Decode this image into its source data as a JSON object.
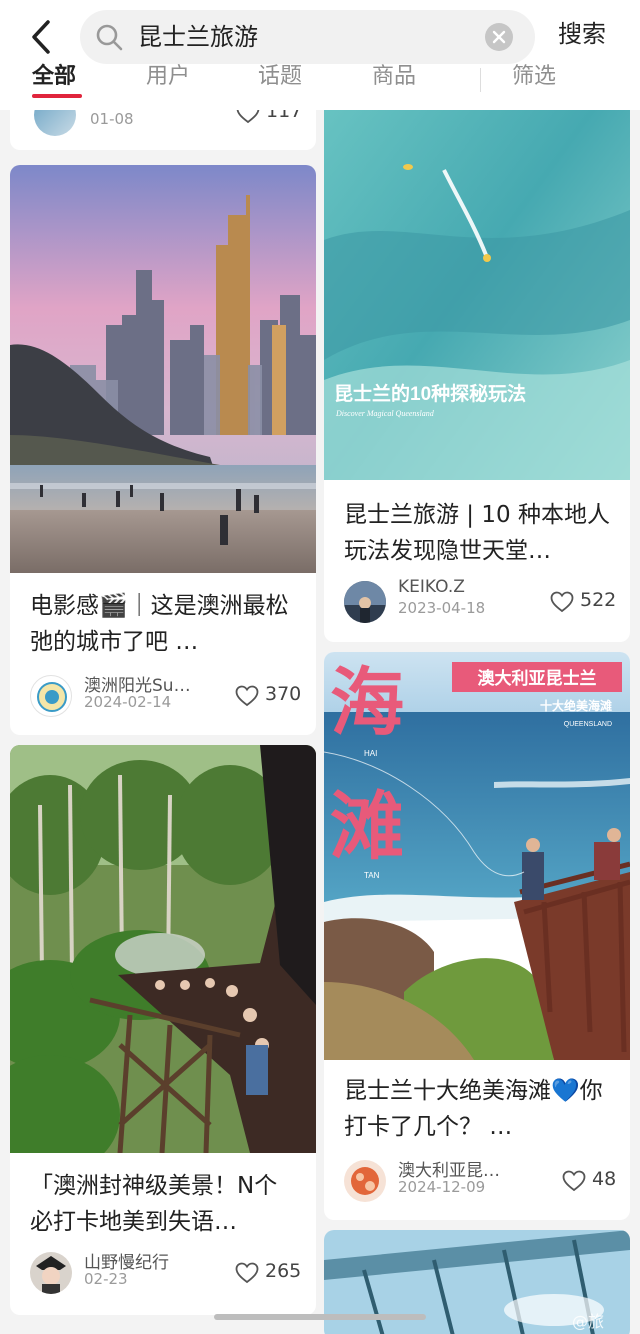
{
  "search": {
    "query": "昆士兰旅游",
    "button_label": "搜索"
  },
  "tabs": [
    "全部",
    "用户",
    "话题",
    "商品",
    "筛选"
  ],
  "cards": {
    "top_left": {
      "date": "01-08",
      "likes": "117"
    },
    "beach_city": {
      "title": "电影感🎬｜这是澳洲最松弛的城市了吧 …",
      "author": "澳洲阳光Su…",
      "date": "2024-02-14",
      "likes": "370"
    },
    "rainforest_train": {
      "title": "「澳洲封神级美景！N个必打卡地美到失语…",
      "author": "山野慢纪行",
      "date": "02-23",
      "likes": "265"
    },
    "ocean_aerial": {
      "overlay_title": "昆士兰的10种探秘玩法",
      "overlay_sub": "Discover Magical Queensland",
      "title": "昆士兰旅游 | 10 种本地人玩法发现隐世天堂…",
      "author": "KEIKO.Z",
      "date": "2023-04-18",
      "likes": "522"
    },
    "beaches": {
      "banner": "澳大利亚昆士兰",
      "sub_banner": "十大绝美海滩",
      "brand": "QUEENSLAND",
      "big1": "海",
      "big2": "滩",
      "pinyin1": "HAI",
      "pinyin2": "TAN",
      "title": "昆士兰十大绝美海滩💙你打卡了几个？ …",
      "author": "澳大利亚昆…",
      "date": "2024-12-09",
      "likes": "48"
    }
  },
  "watermark": "@旅",
  "colors": {
    "accent": "#e0243c",
    "banner_pink": "#e85a7a"
  }
}
